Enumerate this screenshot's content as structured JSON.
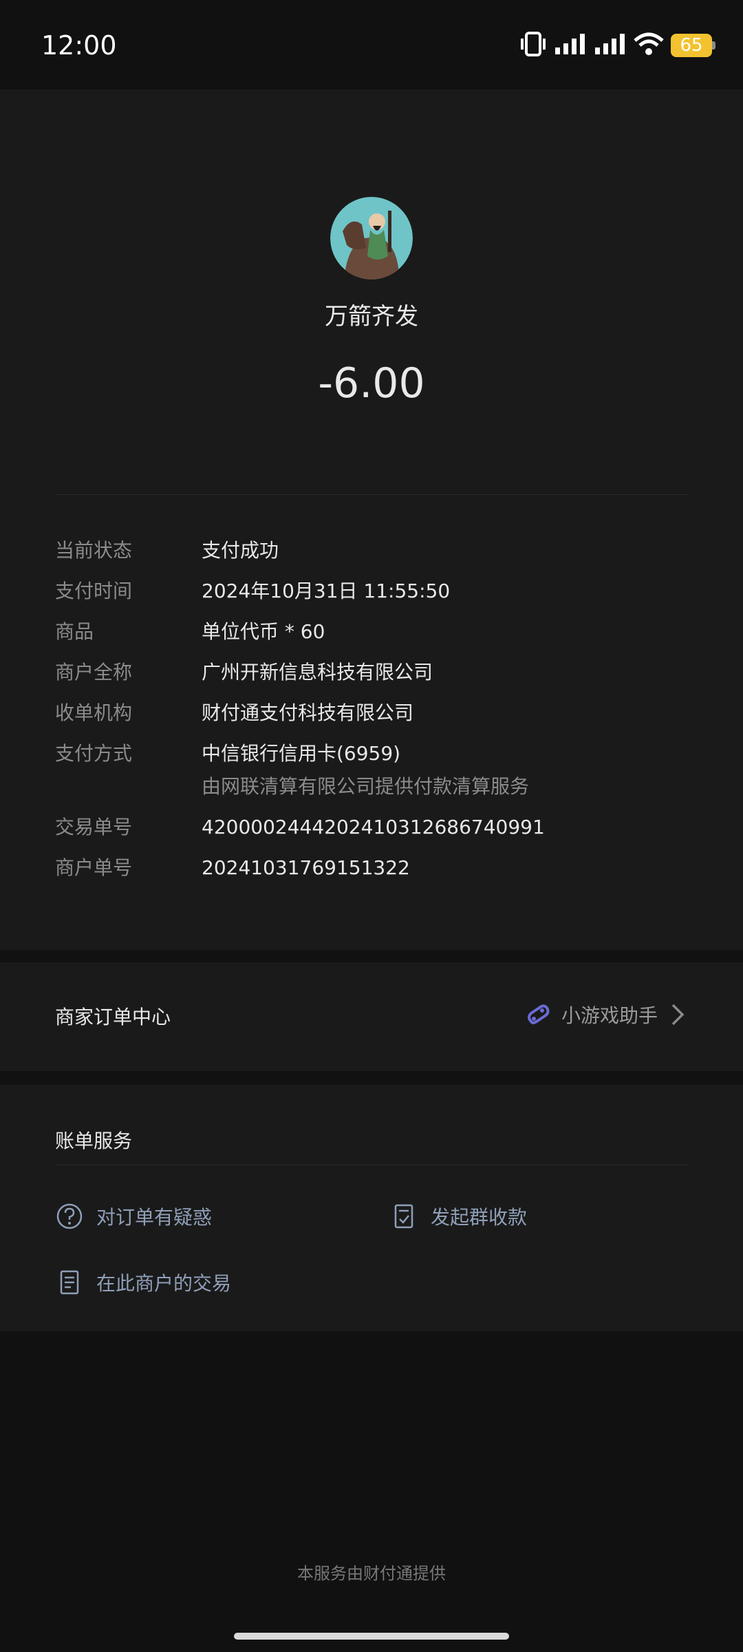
{
  "status_bar": {
    "time": "12:00",
    "battery": "65"
  },
  "header": {
    "close_icon": "close-icon"
  },
  "merchant": {
    "name": "万箭齐发",
    "amount": "-6.00",
    "avatar": "avatar-icon"
  },
  "details": [
    {
      "label": "当前状态",
      "value": "支付成功"
    },
    {
      "label": "支付时间",
      "value": "2024年10月31日 11:55:50"
    },
    {
      "label": "商品",
      "value": "单位代币 * 60"
    },
    {
      "label": "商户全称",
      "value": "广州开新信息科技有限公司"
    },
    {
      "label": "收单机构",
      "value": "财付通支付科技有限公司"
    },
    {
      "label": "支付方式",
      "value": "中信银行信用卡(6959)",
      "sub": "由网联清算有限公司提供付款清算服务"
    },
    {
      "label": "交易单号",
      "value": "4200002444202410312686740991"
    },
    {
      "label": "商户单号",
      "value": "20241031769151322"
    }
  ],
  "merchant_center": {
    "title": "商家订单中心",
    "link_label": "小游戏助手"
  },
  "bill_services": {
    "title": "账单服务",
    "items": [
      {
        "label": "对订单有疑惑",
        "icon": "question-icon"
      },
      {
        "label": "发起群收款",
        "icon": "group-collect-icon"
      },
      {
        "label": "在此商户的交易",
        "icon": "receipt-icon"
      }
    ]
  },
  "footer": {
    "text": "本服务由财付通提供"
  },
  "colors": {
    "accent_link": "#6b6bd6",
    "battery": "#f2c230"
  }
}
